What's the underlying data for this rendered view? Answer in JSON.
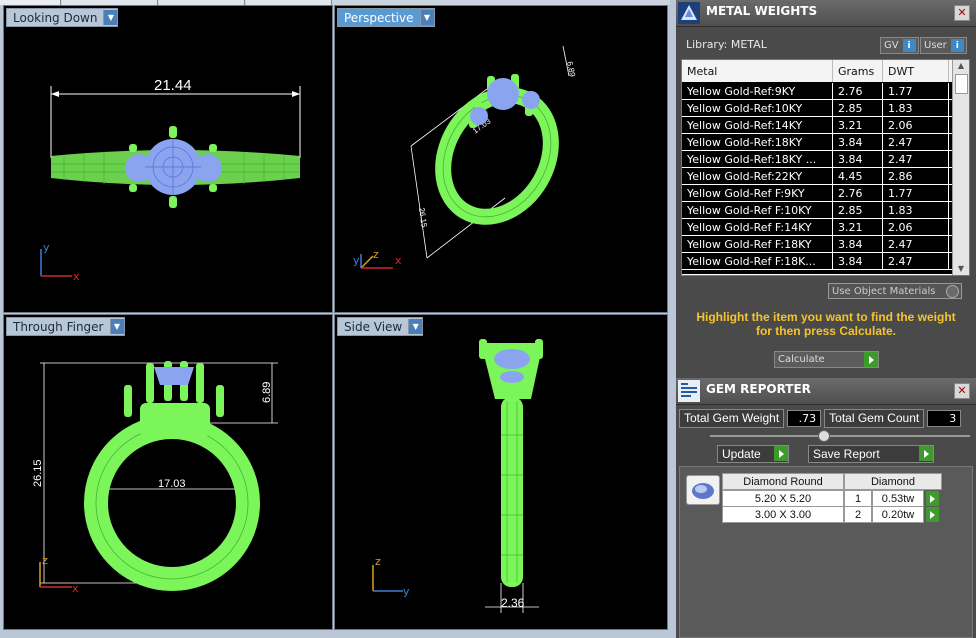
{
  "viewports": {
    "top_left": {
      "label": "Looking Down",
      "dim": "21.44",
      "axes": {
        "a": "y",
        "b": "x"
      }
    },
    "top_right": {
      "label": "Perspective",
      "dim_a": "17.03",
      "dim_b": "26.15",
      "dim_c": "6.89",
      "axes": {
        "a": "y",
        "b": "z",
        "c": "x"
      }
    },
    "bottom_left": {
      "label": "Through Finger",
      "dim_height": "26.15",
      "dim_width": "17.03",
      "dim_top": "6.89",
      "axes": {
        "a": "z",
        "b": "x"
      }
    },
    "bottom_right": {
      "label": "Side View",
      "dim_width": "2.36",
      "axes": {
        "a": "z",
        "b": "y"
      }
    }
  },
  "metal_weights": {
    "title": "METAL WEIGHTS",
    "library": "Library: METAL",
    "gv_label": "GV",
    "user_label": "User",
    "columns": [
      "Metal",
      "Grams",
      "DWT"
    ],
    "rows": [
      [
        "Yellow Gold-Ref:9KY",
        "2.76",
        "1.77"
      ],
      [
        "Yellow Gold-Ref:10KY",
        "2.85",
        "1.83"
      ],
      [
        "Yellow Gold-Ref:14KY",
        "3.21",
        "2.06"
      ],
      [
        "Yellow Gold-Ref:18KY",
        "3.84",
        "2.47"
      ],
      [
        "Yellow Gold-Ref:18KY ...",
        "3.84",
        "2.47"
      ],
      [
        "Yellow Gold-Ref:22KY",
        "4.45",
        "2.86"
      ],
      [
        "Yellow Gold-Ref F:9KY",
        "2.76",
        "1.77"
      ],
      [
        "Yellow Gold-Ref F:10KY",
        "2.85",
        "1.83"
      ],
      [
        "Yellow Gold-Ref F:14KY",
        "3.21",
        "2.06"
      ],
      [
        "Yellow Gold-Ref F:18KY",
        "3.84",
        "2.47"
      ],
      [
        "Yellow Gold-Ref F:18K...",
        "3.84",
        "2.47"
      ]
    ],
    "use_object_materials": "Use Object Materials",
    "hint": "Highlight the item you want to find the weight for then press Calculate.",
    "calculate": "Calculate"
  },
  "gem_reporter": {
    "title": "GEM REPORTER",
    "total_weight_label": "Total Gem Weight",
    "total_weight": ".73",
    "total_count_label": "Total Gem Count",
    "total_count": "3",
    "update": "Update",
    "save_report": "Save Report",
    "shape_header": "Diamond Round",
    "material_header": "Diamond",
    "gems": [
      {
        "size": "5.20 X 5.20",
        "count": "1",
        "weight": "0.53tw"
      },
      {
        "size": "3.00 X 3.00",
        "count": "2",
        "weight": "0.20tw"
      }
    ]
  },
  "colors": {
    "ring": "#7cf55a",
    "gem": "#8aa4f0",
    "panel": "#4a4a4a",
    "hint": "#f5c42c"
  }
}
